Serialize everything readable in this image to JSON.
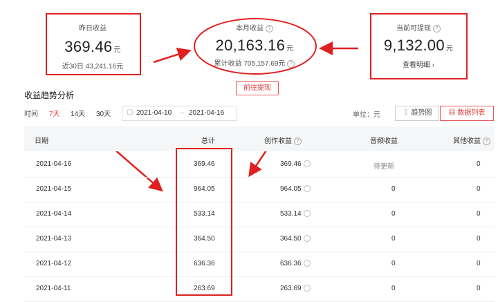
{
  "cards": {
    "yesterday": {
      "label": "昨日收益",
      "value": "369.46",
      "unit": "元",
      "sub": "近30日 43,241.16元"
    },
    "month": {
      "label": "本月收益",
      "value": "20,163.16",
      "unit": "元",
      "sub": "累计收益 705,157.69元"
    },
    "withdrawable": {
      "label": "当前可提现",
      "value": "9,132.00",
      "unit": "元",
      "link": "查看明细 ›"
    }
  },
  "withdraw_button": "前往提现",
  "section_title": "收益趋势分析",
  "time_filter": {
    "label": "时间",
    "options": [
      "7天",
      "14天",
      "30天"
    ],
    "active": "7天"
  },
  "date_range": {
    "start": "2021-04-10",
    "sep": "–",
    "end": "2021-04-16"
  },
  "unit_label": "单位：元",
  "view_toggle": {
    "trend": "趋势图",
    "list": "数据列表"
  },
  "table": {
    "headers": [
      "日期",
      "总计",
      "创作收益",
      "音频收益",
      "其他收益"
    ],
    "rows": [
      {
        "date": "2021-04-16",
        "total": "369.46",
        "creation": "369.46",
        "audio": "待更新",
        "other": "0"
      },
      {
        "date": "2021-04-15",
        "total": "964.05",
        "creation": "964.05",
        "audio": "0",
        "other": "0"
      },
      {
        "date": "2021-04-14",
        "total": "533.14",
        "creation": "533.14",
        "audio": "0",
        "other": "0"
      },
      {
        "date": "2021-04-13",
        "total": "364.50",
        "creation": "364.50",
        "audio": "0",
        "other": "0"
      },
      {
        "date": "2021-04-12",
        "total": "636.36",
        "creation": "636.36",
        "audio": "0",
        "other": "0"
      },
      {
        "date": "2021-04-11",
        "total": "263.69",
        "creation": "263.69",
        "audio": "0",
        "other": "0"
      }
    ]
  },
  "colors": {
    "accent": "#e03a3a",
    "annotation": "#e02020"
  }
}
